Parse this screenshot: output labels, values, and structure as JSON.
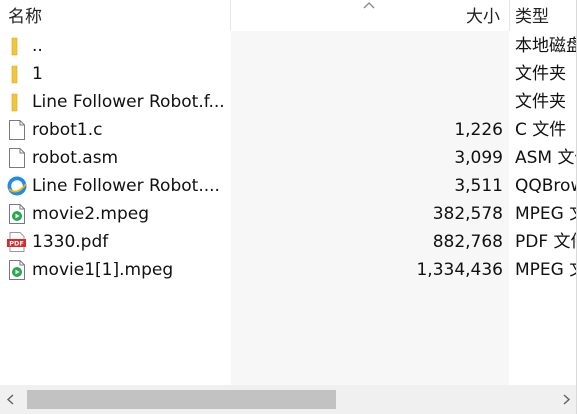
{
  "header": {
    "col_name": "名称",
    "col_size": "大小",
    "col_type": "类型",
    "sort_icon": "chevron-up-icon"
  },
  "files": [
    {
      "name": "..",
      "size": "",
      "type": "本地磁盘",
      "icon": "folder-icon"
    },
    {
      "name": "1",
      "size": "",
      "type": "文件夹",
      "icon": "folder-icon"
    },
    {
      "name": "Line Follower Robot.f...",
      "size": "",
      "type": "文件夹",
      "icon": "folder-icon"
    },
    {
      "name": "robot1.c",
      "size": "1,226",
      "type": "C 文件",
      "icon": "document-icon"
    },
    {
      "name": "robot.asm",
      "size": "3,099",
      "type": "ASM 文件",
      "icon": "document-icon"
    },
    {
      "name": "Line Follower Robot....",
      "size": "3,511",
      "type": "QQBrowser",
      "icon": "qqbrowser-icon"
    },
    {
      "name": "movie2.mpeg",
      "size": "382,578",
      "type": "MPEG 文件",
      "icon": "video-file-icon"
    },
    {
      "name": "1330.pdf",
      "size": "882,768",
      "type": "PDF 文件",
      "icon": "pdf-icon"
    },
    {
      "name": "movie1[1].mpeg",
      "size": "1,334,436",
      "type": "MPEG 文件",
      "icon": "video-file-icon"
    }
  ],
  "scrollbar": {
    "left_icon": "chevron-left-icon",
    "right_icon": "chevron-right-icon",
    "thumb_fraction": 0.58
  },
  "colors": {
    "folder": "#f3c53f",
    "pdf": "#d92b2b",
    "qq_blue": "#1f8ce8",
    "video_green": "#27a852"
  }
}
